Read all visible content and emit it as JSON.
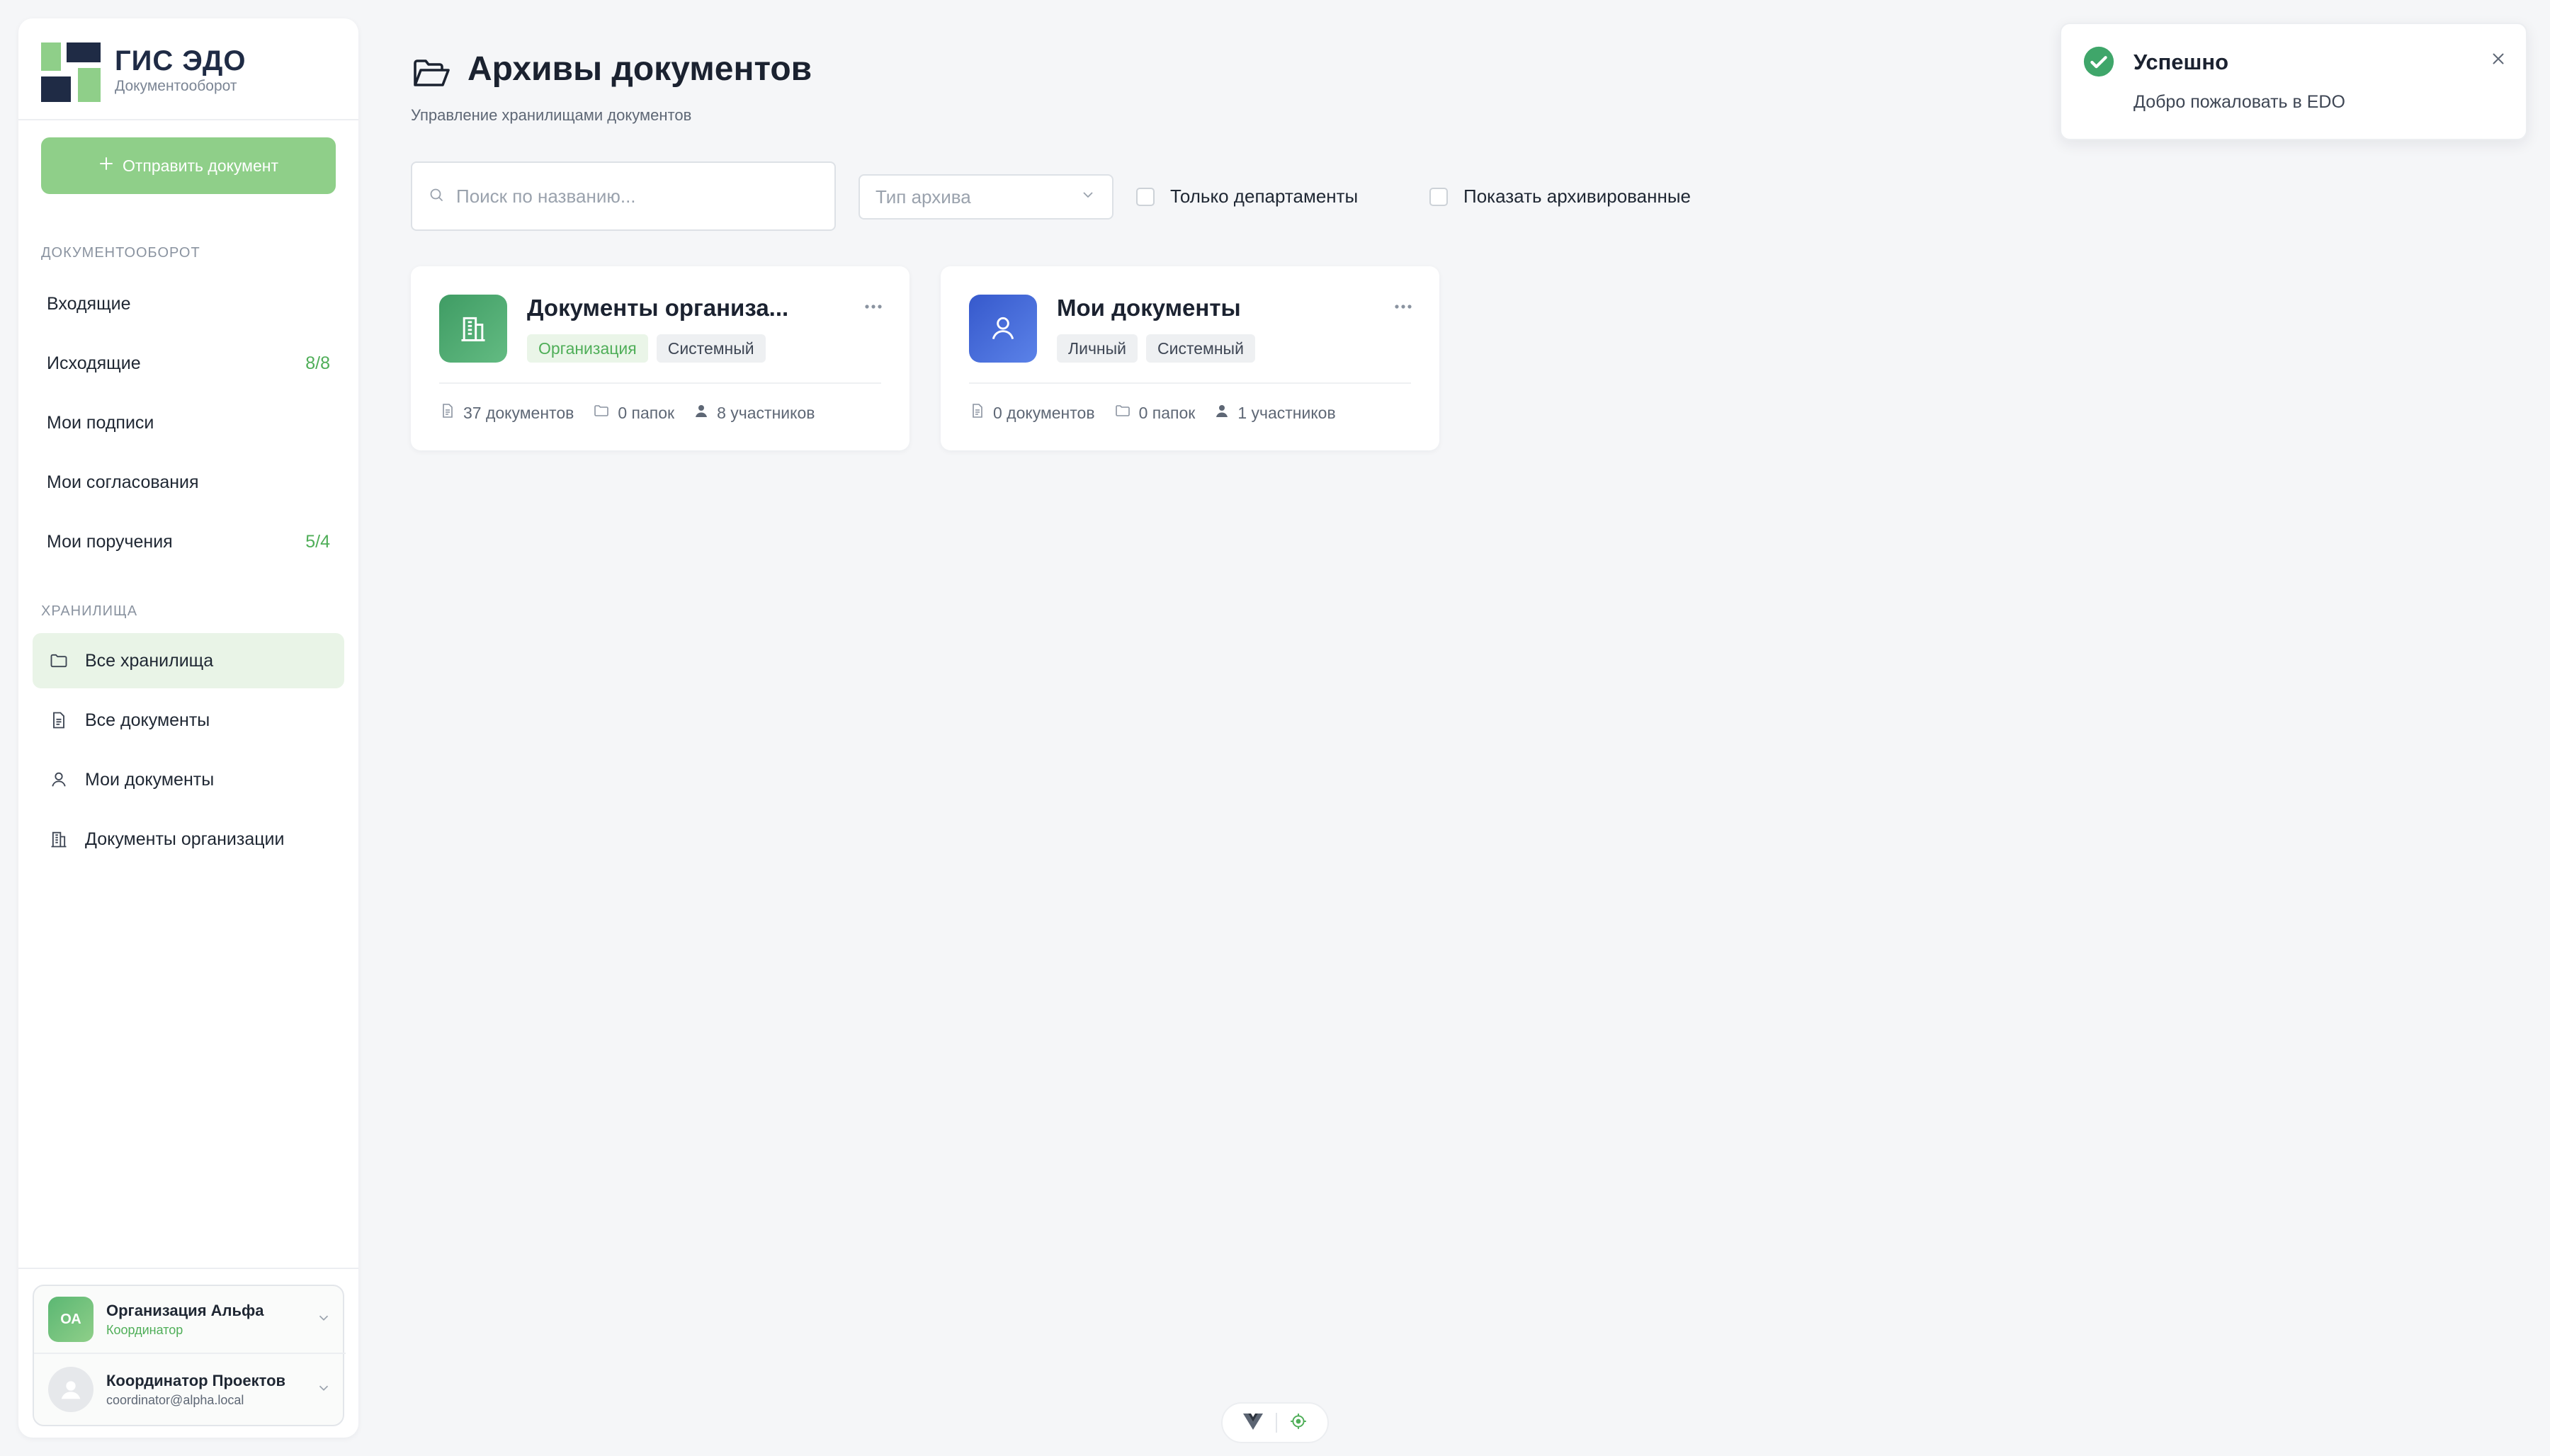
{
  "brand": {
    "title": "ГИС ЭДО",
    "subtitle": "Документооборот"
  },
  "sidebar": {
    "send_button_label": "Отправить документ",
    "section_docflow": "Документооборот",
    "docflow_items": [
      {
        "label": "Входящие",
        "count": ""
      },
      {
        "label": "Исходящие",
        "count": "8/8"
      },
      {
        "label": "Мои подписи",
        "count": ""
      },
      {
        "label": "Мои согласования",
        "count": ""
      },
      {
        "label": "Мои поручения",
        "count": "5/4"
      }
    ],
    "section_storage": "Хранилища",
    "storage_items": [
      {
        "label": "Все хранилища",
        "icon": "folder-icon",
        "active": true
      },
      {
        "label": "Все документы",
        "icon": "document-icon",
        "active": false
      },
      {
        "label": "Мои документы",
        "icon": "user-icon",
        "active": false
      },
      {
        "label": "Документы организации",
        "icon": "building-icon",
        "active": false
      }
    ]
  },
  "account": {
    "org_initials": "ОА",
    "org_name": "Организация Альфа",
    "org_role": "Координатор",
    "user_name": "Координатор Проектов",
    "user_email": "coordinator@alpha.local"
  },
  "main": {
    "title": "Архивы документов",
    "subtitle": "Управление хранилищами документов",
    "search_placeholder": "Поиск по названию...",
    "type_select_placeholder": "Тип архива",
    "filter_departments": "Только департаменты",
    "filter_archived": "Показать архивированные",
    "cards": [
      {
        "title": "Документы организа...",
        "icon": "building-icon",
        "tags": [
          {
            "label": "Организация",
            "style": "green"
          },
          {
            "label": "Системный",
            "style": "gray"
          }
        ],
        "documents": "37 документов",
        "folders": "0 папок",
        "members": "8 участников"
      },
      {
        "title": "Мои документы",
        "icon": "user-icon",
        "tags": [
          {
            "label": "Личный",
            "style": "gray"
          },
          {
            "label": "Системный",
            "style": "gray"
          }
        ],
        "documents": "0 документов",
        "folders": "0 папок",
        "members": "1 участников"
      }
    ]
  },
  "toast": {
    "title": "Успешно",
    "message": "Добро пожаловать в EDO"
  },
  "colors": {
    "accent_green": "#4fae58",
    "button_green": "#8fcf89",
    "org_card_icon": "#4aa66e",
    "user_card_icon": "#3f66d6",
    "navy": "#1f2b45"
  }
}
